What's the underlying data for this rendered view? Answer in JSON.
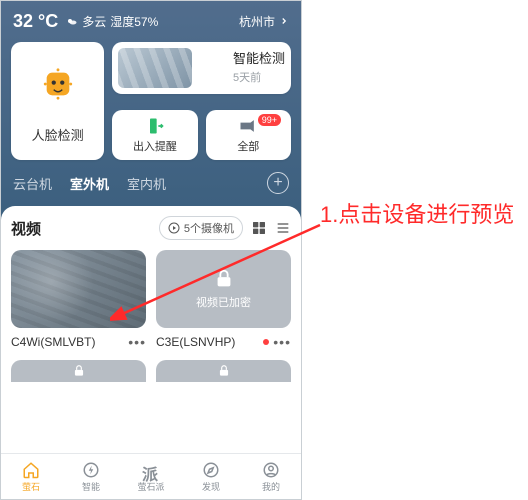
{
  "weather": {
    "temp": "32 °C",
    "cond": "多云",
    "humidity_label": "湿度57%",
    "location": "杭州市"
  },
  "face_card": {
    "label": "人脸检测"
  },
  "smart_card": {
    "title": "智能检测",
    "sub": "5天前"
  },
  "entry_card": {
    "label": "出入提醒"
  },
  "all_card": {
    "label": "全部",
    "badge": "99+"
  },
  "tabs": [
    "云台机",
    "室外机",
    "室内机"
  ],
  "tabs_active_index": 1,
  "section": {
    "title": "视频",
    "cam_count_label": "5个摄像机"
  },
  "cams": [
    {
      "name": "C4Wi(SMLVBT)",
      "locked": false,
      "online": false
    },
    {
      "name": "C3E(LSNVHP)",
      "locked": true,
      "online": true,
      "locked_text": "视频已加密"
    }
  ],
  "nav": [
    {
      "label": "萤石",
      "icon": "home"
    },
    {
      "label": "智能",
      "icon": "bolt"
    },
    {
      "label": "萤石派",
      "icon": "pai"
    },
    {
      "label": "发现",
      "icon": "discover"
    },
    {
      "label": "我的",
      "icon": "me"
    }
  ],
  "nav_active_index": 0,
  "annotation": "1.点击设备进行预览"
}
